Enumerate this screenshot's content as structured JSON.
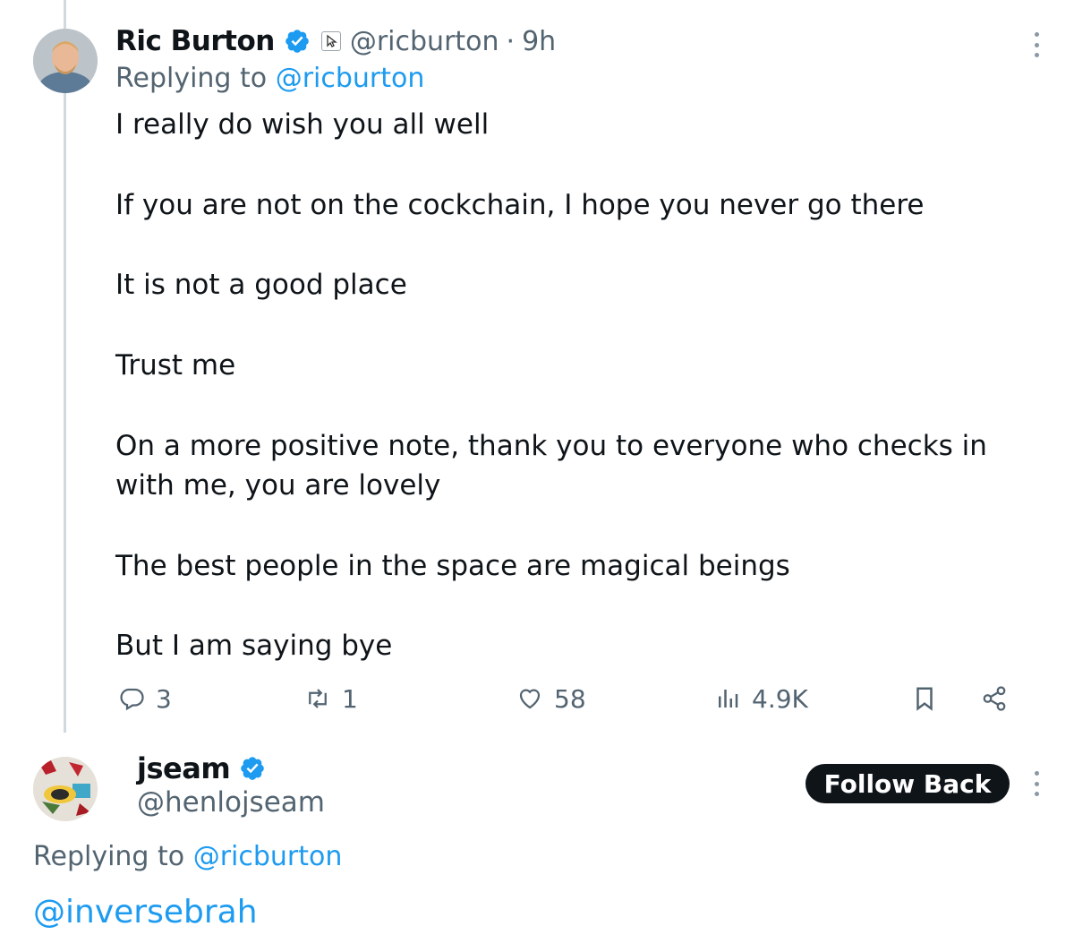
{
  "tweet1": {
    "author_name": "Ric Burton",
    "handle": "@ricburton",
    "separator": "·",
    "time": "9h",
    "replying_label": "Replying to",
    "replying_to": "@ricburton",
    "lines": [
      "I really do wish you all well",
      "If you are not on the cockchain, I hope you never go there",
      "It is not a good place",
      "Trust me",
      "On a more positive note, thank you to everyone who checks in",
      "with me, you are lovely",
      "The best people in the space are magical beings",
      "But I am saying bye"
    ],
    "actions": {
      "replies": "3",
      "retweets": "1",
      "likes": "58",
      "views": "4.9K"
    },
    "icons": [
      "verified-badge-icon",
      "affiliate-icon",
      "more-icon",
      "reply-icon",
      "retweet-icon",
      "like-icon",
      "views-icon",
      "bookmark-icon",
      "share-icon"
    ]
  },
  "tweet2": {
    "author_name": "jseam",
    "handle": "@henlojseam",
    "follow_label": "Follow Back",
    "replying_label": "Replying to",
    "replying_to": "@ricburton",
    "text": "@inversebrah"
  },
  "colors": {
    "accent": "#1d9bf0",
    "secondary_text": "#536471",
    "primary_text": "#0f1419",
    "thread_line": "#cfd9de"
  }
}
